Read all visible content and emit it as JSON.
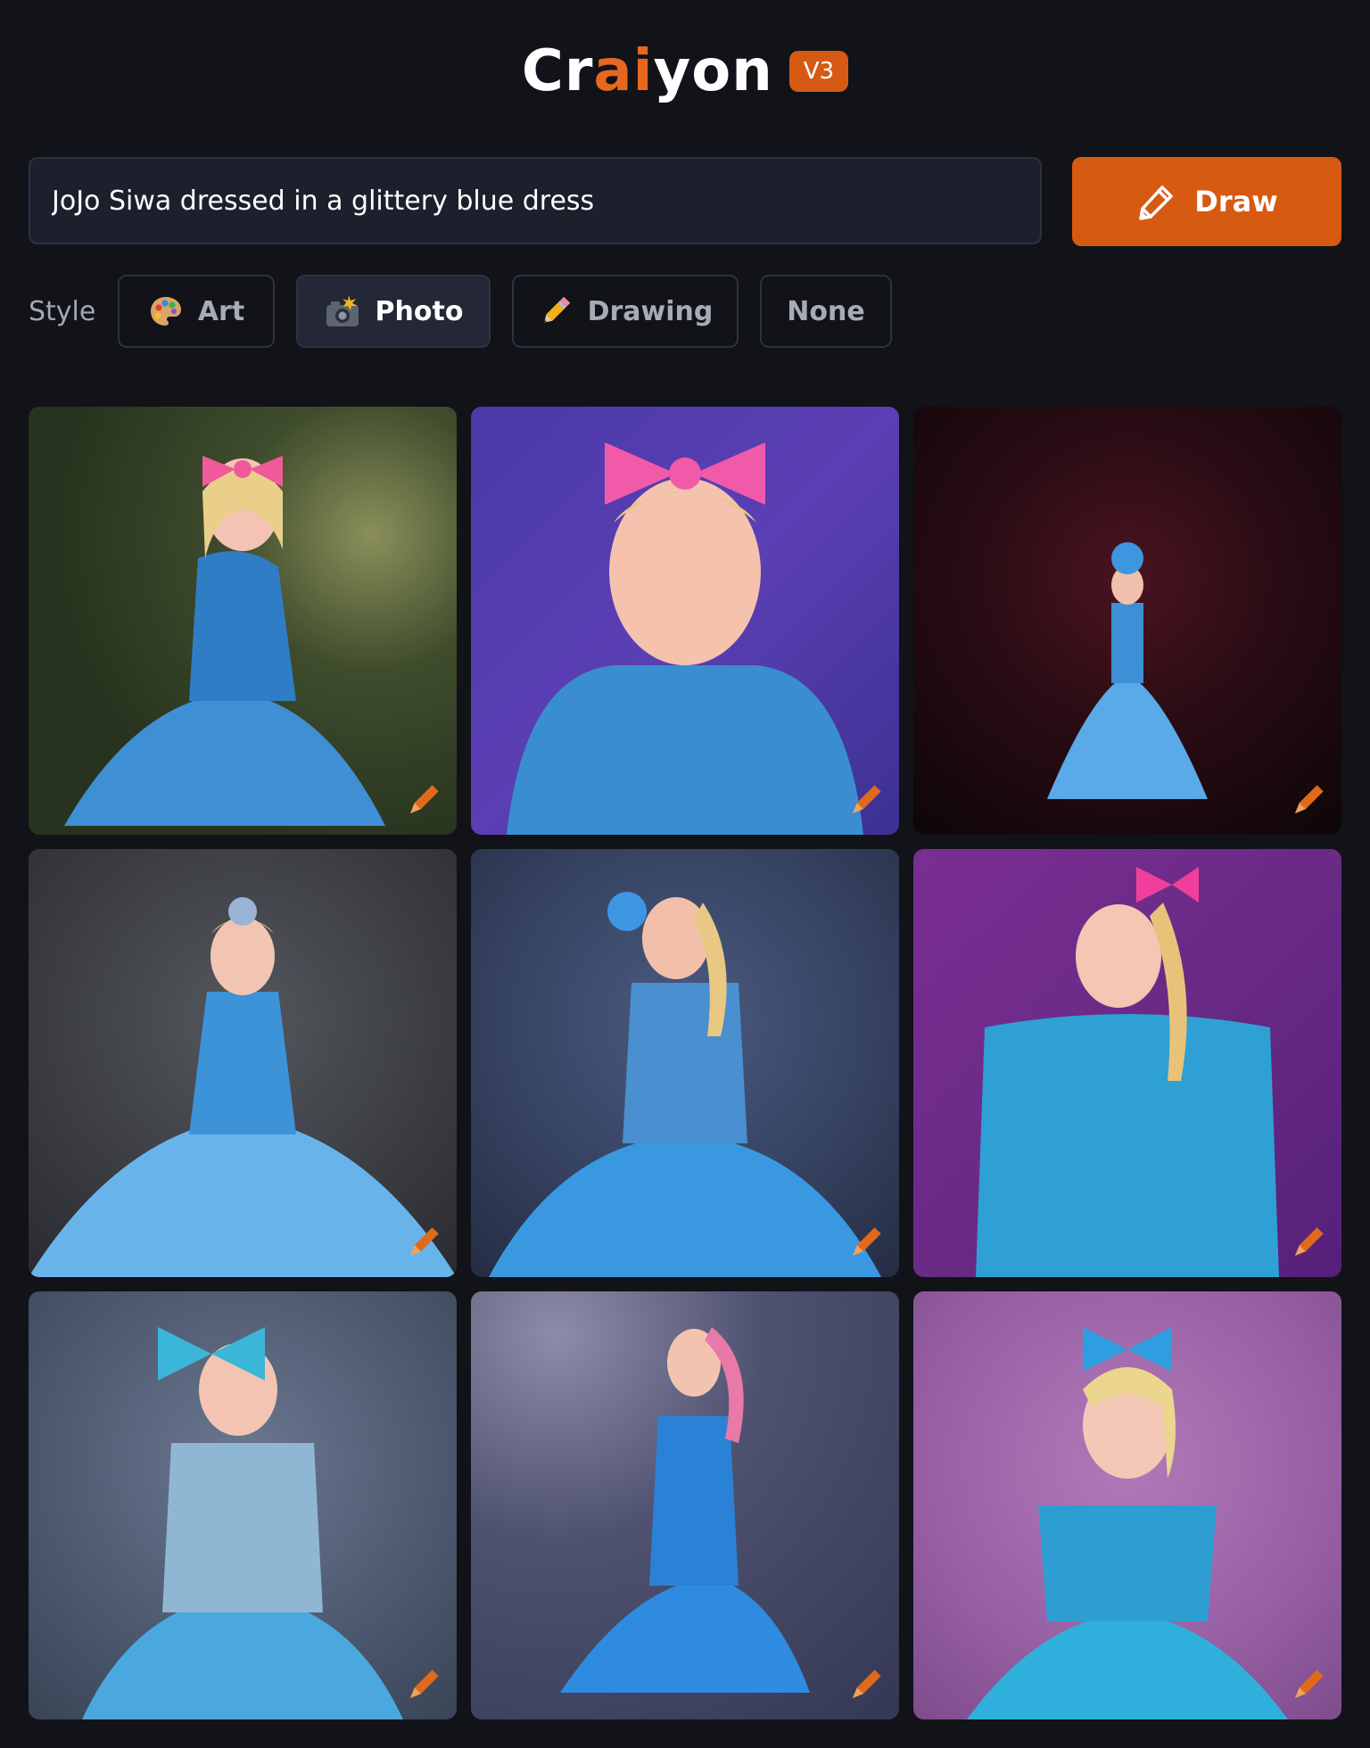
{
  "header": {
    "logo": {
      "part1": "Cr",
      "part2": "ai",
      "part3": "yon"
    },
    "version": "V3"
  },
  "prompt": {
    "value": "JoJo Siwa dressed in a glittery blue dress"
  },
  "draw_button": {
    "label": "Draw",
    "icon": "pencil-icon"
  },
  "style": {
    "label": "Style",
    "options": [
      {
        "label": "Art",
        "icon": "palette-icon",
        "selected": false
      },
      {
        "label": "Photo",
        "icon": "camera-flash-icon",
        "selected": true
      },
      {
        "label": "Drawing",
        "icon": "pencil-icon",
        "selected": false
      },
      {
        "label": "None",
        "icon": "",
        "selected": false
      }
    ]
  },
  "results": {
    "images": [
      {
        "edit_icon": "pencil-icon"
      },
      {
        "edit_icon": "pencil-icon"
      },
      {
        "edit_icon": "pencil-icon"
      },
      {
        "edit_icon": "pencil-icon"
      },
      {
        "edit_icon": "pencil-icon"
      },
      {
        "edit_icon": "pencil-icon"
      },
      {
        "edit_icon": "pencil-icon"
      },
      {
        "edit_icon": "pencil-icon"
      },
      {
        "edit_icon": "pencil-icon"
      }
    ]
  },
  "colors": {
    "background": "#111319",
    "accent": "#d65a12",
    "input_background": "#1c1f2c"
  }
}
